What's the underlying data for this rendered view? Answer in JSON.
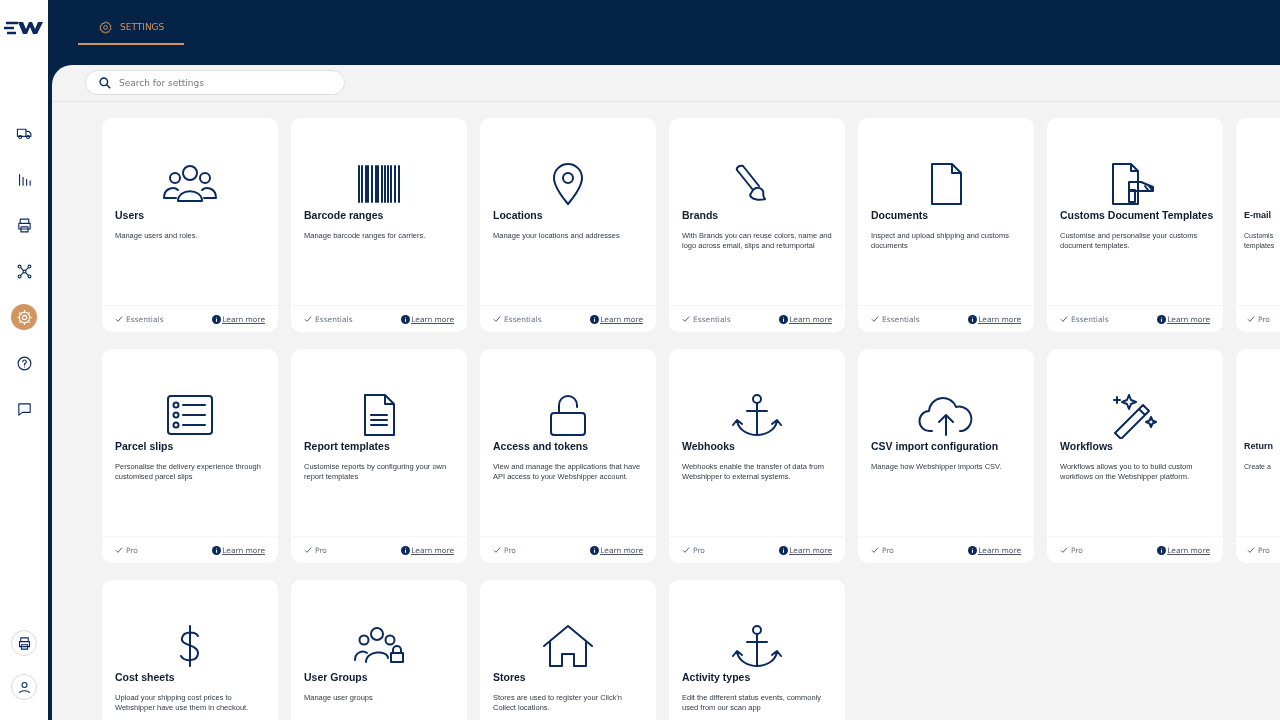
{
  "header": {
    "tab": {
      "label": "SETTINGS",
      "selected": true
    }
  },
  "sidebar": {
    "items": [
      {
        "selected": false
      },
      {
        "selected": false
      },
      {
        "selected": false
      },
      {
        "selected": false
      },
      {
        "selected": true
      },
      {
        "selected": false
      },
      {
        "selected": false
      }
    ],
    "bottom_items": [
      {
        "selected": false
      },
      {
        "selected": false
      }
    ]
  },
  "search": {
    "placeholder": "Search for settings"
  },
  "cards": [
    {
      "kind": "full",
      "title": "Users",
      "description": "Manage users and roles.",
      "plan": "Essentials",
      "link": "Learn more"
    },
    {
      "kind": "full",
      "title": "Barcode ranges",
      "description": "Manage barcode ranges for carriers.",
      "plan": "Essentials",
      "link": "Learn more"
    },
    {
      "kind": "full",
      "title": "Locations",
      "description": "Manage your locations and addresses",
      "plan": "Essentials",
      "link": "Learn more"
    },
    {
      "kind": "full",
      "title": "Brands",
      "description": "With Brands you can reuse colors, name and logo across email, slips and returnportal",
      "plan": "Essentials",
      "link": "Learn more"
    },
    {
      "kind": "full",
      "title": "Documents",
      "description": "Inspect and upload shipping and customs documents",
      "plan": "Essentials",
      "link": "Learn more"
    },
    {
      "kind": "full",
      "title": "Customs Document Templates",
      "description": "Customise and personalise your customs document templates.",
      "plan": "Essentials",
      "link": "Learn more"
    },
    {
      "kind": "partial",
      "title": "E-mail",
      "description": "Customis templates",
      "plan": "Pro"
    },
    {
      "kind": "full",
      "title": "Parcel slips",
      "description": "Personalise the delivery experience through customised parcel slips",
      "plan": "Pro",
      "link": "Learn more"
    },
    {
      "kind": "full",
      "title": "Report templates",
      "description": "Customise reports by configuring your own report templates",
      "plan": "Pro",
      "link": "Learn more"
    },
    {
      "kind": "full",
      "title": "Access and tokens",
      "description": "View and manage the applications that have API access to your Webshipper account.",
      "plan": "Pro",
      "link": "Learn more"
    },
    {
      "kind": "full",
      "title": "Webhooks",
      "description": "Webhooks enable the transfer of data from Webshipper to external systems.",
      "plan": "Pro",
      "link": "Learn more"
    },
    {
      "kind": "full",
      "title": "CSV import configuration",
      "description": "Manage how Webshipper imports CSV.",
      "plan": "Pro",
      "link": "Learn more"
    },
    {
      "kind": "full",
      "title": "Workflows",
      "description": "Workflows allows you to to build custom workflows on the Webshipper platform.",
      "plan": "Pro",
      "link": "Learn more"
    },
    {
      "kind": "partial",
      "title": "Return",
      "description": "Create a",
      "plan": "Pro"
    },
    {
      "kind": "full",
      "title": "Cost sheets",
      "description": "Upload your shipping cost prices to Webshipper have use them in checkout."
    },
    {
      "kind": "full",
      "title": "User Groups",
      "description": "Manage user groups"
    },
    {
      "kind": "full",
      "title": "Stores",
      "description": "Stores are used to register your Click'n Collect locations."
    },
    {
      "kind": "full",
      "title": "Activity types",
      "description": "Edit the different status events, commonly used from our scan app"
    }
  ]
}
